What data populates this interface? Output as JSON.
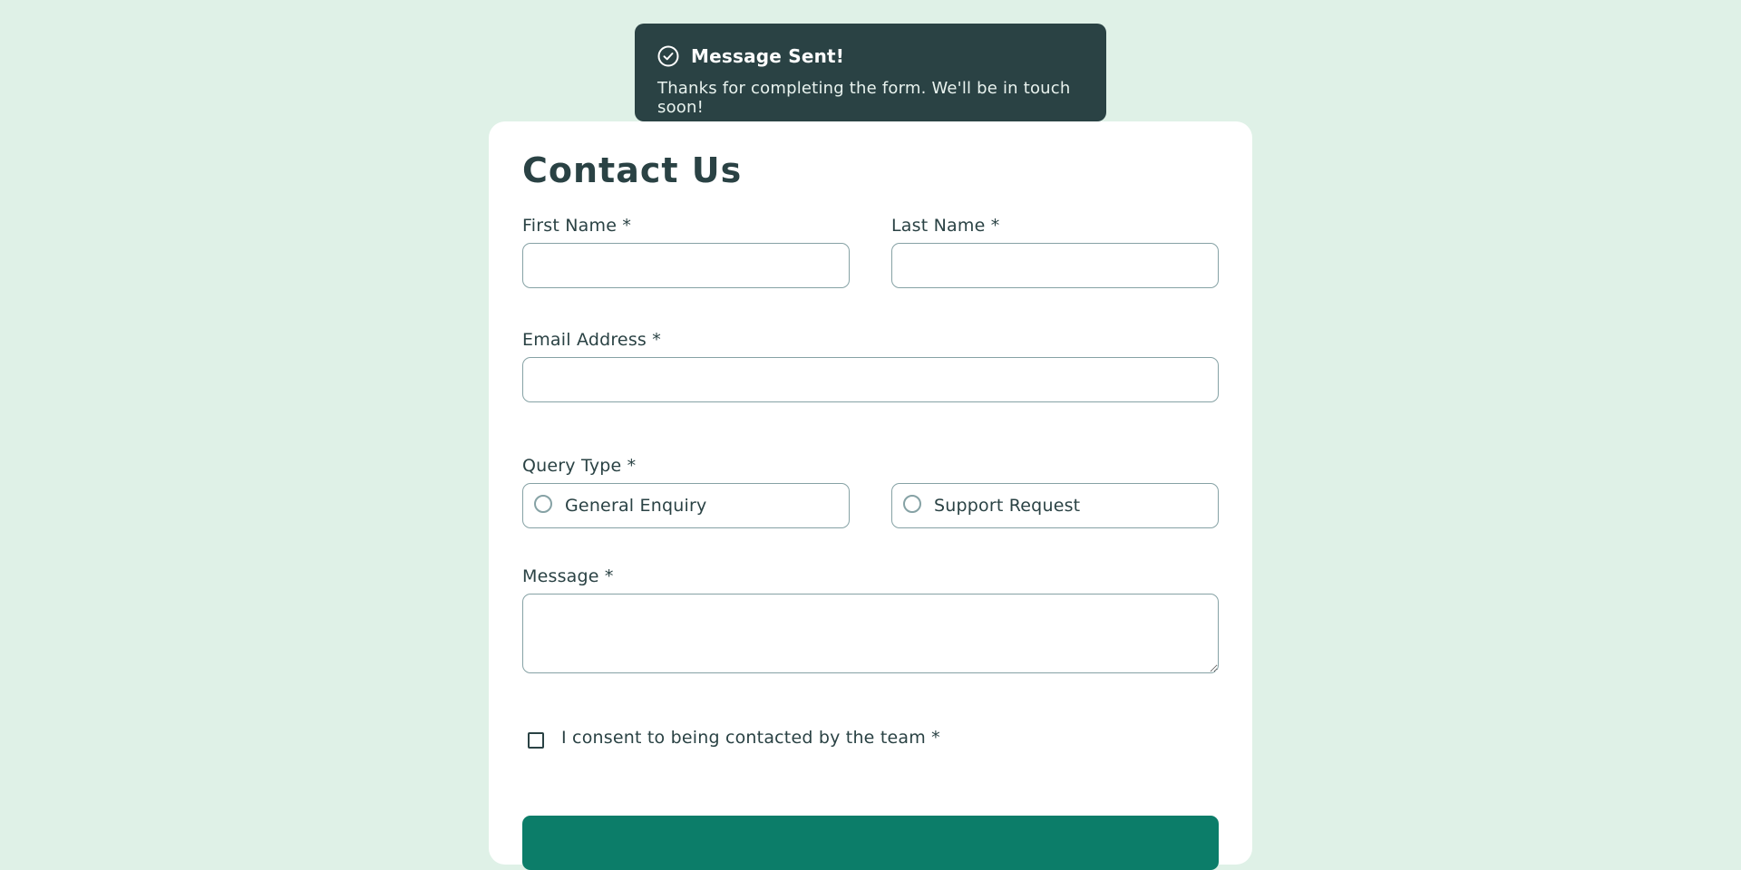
{
  "toast": {
    "icon": "check-circle-icon",
    "title": "Message Sent!",
    "text": "Thanks for completing the form. We'll be in touch soon!"
  },
  "form": {
    "title": "Contact Us",
    "first_name": {
      "label": "First Name *",
      "value": ""
    },
    "last_name": {
      "label": "Last Name *",
      "value": ""
    },
    "email": {
      "label": "Email Address *",
      "value": ""
    },
    "query_type": {
      "label": "Query Type *",
      "options": [
        "General Enquiry",
        "Support Request"
      ]
    },
    "message": {
      "label": "Message *",
      "value": ""
    },
    "consent": {
      "label": "I consent to being contacted by the team *",
      "checked": false
    },
    "submit_label": ""
  },
  "colors": {
    "background": "#dff1e7",
    "toast_bg": "#2a4244",
    "text": "#2a4244",
    "border": "#86a2a5",
    "accent": "#0c7d69"
  }
}
